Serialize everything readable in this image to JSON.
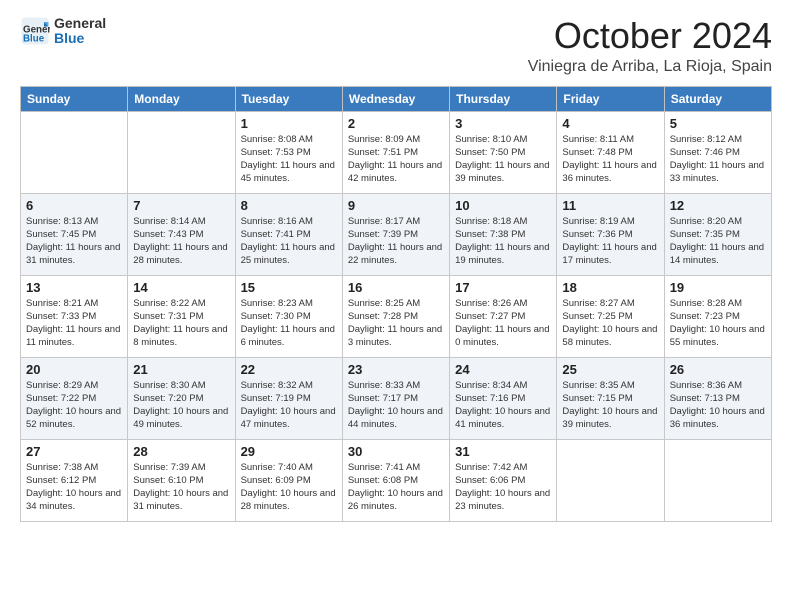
{
  "logo": {
    "line1": "General",
    "line2": "Blue"
  },
  "title": "October 2024",
  "location": "Viniegra de Arriba, La Rioja, Spain",
  "weekdays": [
    "Sunday",
    "Monday",
    "Tuesday",
    "Wednesday",
    "Thursday",
    "Friday",
    "Saturday"
  ],
  "weeks": [
    [
      {
        "day": "",
        "info": ""
      },
      {
        "day": "",
        "info": ""
      },
      {
        "day": "1",
        "info": "Sunrise: 8:08 AM\nSunset: 7:53 PM\nDaylight: 11 hours and 45 minutes."
      },
      {
        "day": "2",
        "info": "Sunrise: 8:09 AM\nSunset: 7:51 PM\nDaylight: 11 hours and 42 minutes."
      },
      {
        "day": "3",
        "info": "Sunrise: 8:10 AM\nSunset: 7:50 PM\nDaylight: 11 hours and 39 minutes."
      },
      {
        "day": "4",
        "info": "Sunrise: 8:11 AM\nSunset: 7:48 PM\nDaylight: 11 hours and 36 minutes."
      },
      {
        "day": "5",
        "info": "Sunrise: 8:12 AM\nSunset: 7:46 PM\nDaylight: 11 hours and 33 minutes."
      }
    ],
    [
      {
        "day": "6",
        "info": "Sunrise: 8:13 AM\nSunset: 7:45 PM\nDaylight: 11 hours and 31 minutes."
      },
      {
        "day": "7",
        "info": "Sunrise: 8:14 AM\nSunset: 7:43 PM\nDaylight: 11 hours and 28 minutes."
      },
      {
        "day": "8",
        "info": "Sunrise: 8:16 AM\nSunset: 7:41 PM\nDaylight: 11 hours and 25 minutes."
      },
      {
        "day": "9",
        "info": "Sunrise: 8:17 AM\nSunset: 7:39 PM\nDaylight: 11 hours and 22 minutes."
      },
      {
        "day": "10",
        "info": "Sunrise: 8:18 AM\nSunset: 7:38 PM\nDaylight: 11 hours and 19 minutes."
      },
      {
        "day": "11",
        "info": "Sunrise: 8:19 AM\nSunset: 7:36 PM\nDaylight: 11 hours and 17 minutes."
      },
      {
        "day": "12",
        "info": "Sunrise: 8:20 AM\nSunset: 7:35 PM\nDaylight: 11 hours and 14 minutes."
      }
    ],
    [
      {
        "day": "13",
        "info": "Sunrise: 8:21 AM\nSunset: 7:33 PM\nDaylight: 11 hours and 11 minutes."
      },
      {
        "day": "14",
        "info": "Sunrise: 8:22 AM\nSunset: 7:31 PM\nDaylight: 11 hours and 8 minutes."
      },
      {
        "day": "15",
        "info": "Sunrise: 8:23 AM\nSunset: 7:30 PM\nDaylight: 11 hours and 6 minutes."
      },
      {
        "day": "16",
        "info": "Sunrise: 8:25 AM\nSunset: 7:28 PM\nDaylight: 11 hours and 3 minutes."
      },
      {
        "day": "17",
        "info": "Sunrise: 8:26 AM\nSunset: 7:27 PM\nDaylight: 11 hours and 0 minutes."
      },
      {
        "day": "18",
        "info": "Sunrise: 8:27 AM\nSunset: 7:25 PM\nDaylight: 10 hours and 58 minutes."
      },
      {
        "day": "19",
        "info": "Sunrise: 8:28 AM\nSunset: 7:23 PM\nDaylight: 10 hours and 55 minutes."
      }
    ],
    [
      {
        "day": "20",
        "info": "Sunrise: 8:29 AM\nSunset: 7:22 PM\nDaylight: 10 hours and 52 minutes."
      },
      {
        "day": "21",
        "info": "Sunrise: 8:30 AM\nSunset: 7:20 PM\nDaylight: 10 hours and 49 minutes."
      },
      {
        "day": "22",
        "info": "Sunrise: 8:32 AM\nSunset: 7:19 PM\nDaylight: 10 hours and 47 minutes."
      },
      {
        "day": "23",
        "info": "Sunrise: 8:33 AM\nSunset: 7:17 PM\nDaylight: 10 hours and 44 minutes."
      },
      {
        "day": "24",
        "info": "Sunrise: 8:34 AM\nSunset: 7:16 PM\nDaylight: 10 hours and 41 minutes."
      },
      {
        "day": "25",
        "info": "Sunrise: 8:35 AM\nSunset: 7:15 PM\nDaylight: 10 hours and 39 minutes."
      },
      {
        "day": "26",
        "info": "Sunrise: 8:36 AM\nSunset: 7:13 PM\nDaylight: 10 hours and 36 minutes."
      }
    ],
    [
      {
        "day": "27",
        "info": "Sunrise: 7:38 AM\nSunset: 6:12 PM\nDaylight: 10 hours and 34 minutes."
      },
      {
        "day": "28",
        "info": "Sunrise: 7:39 AM\nSunset: 6:10 PM\nDaylight: 10 hours and 31 minutes."
      },
      {
        "day": "29",
        "info": "Sunrise: 7:40 AM\nSunset: 6:09 PM\nDaylight: 10 hours and 28 minutes."
      },
      {
        "day": "30",
        "info": "Sunrise: 7:41 AM\nSunset: 6:08 PM\nDaylight: 10 hours and 26 minutes."
      },
      {
        "day": "31",
        "info": "Sunrise: 7:42 AM\nSunset: 6:06 PM\nDaylight: 10 hours and 23 minutes."
      },
      {
        "day": "",
        "info": ""
      },
      {
        "day": "",
        "info": ""
      }
    ]
  ]
}
